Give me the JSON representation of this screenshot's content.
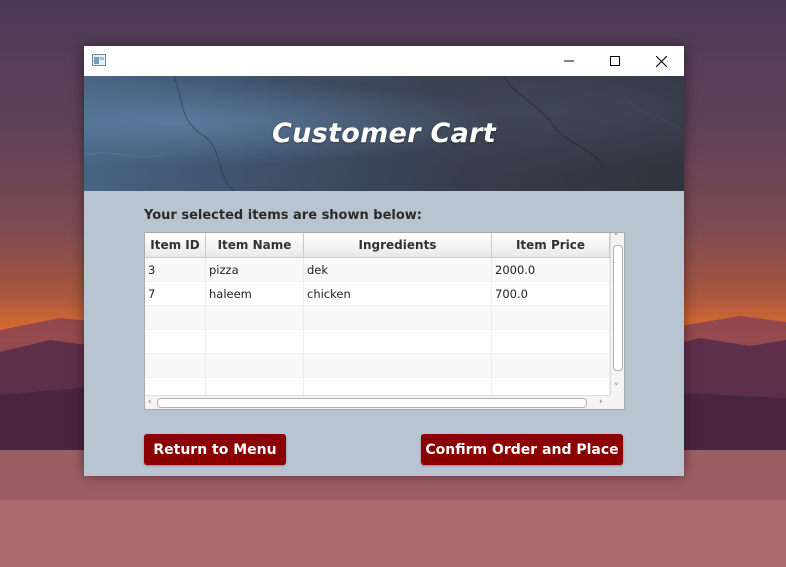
{
  "window": {
    "icon": "app-window-icon",
    "controls": {
      "minimize_icon": "minimize-icon",
      "maximize_icon": "maximize-icon",
      "close_icon": "close-icon"
    }
  },
  "banner": {
    "title": "Customer Cart"
  },
  "cart": {
    "subtitle": "Your selected items are shown below:",
    "columns": [
      "Item ID",
      "Item Name",
      "Ingredients",
      "Item Price"
    ],
    "rows": [
      [
        "3",
        "pizza",
        "dek",
        "2000.0"
      ],
      [
        "7",
        "haleem",
        "chicken",
        "700.0"
      ],
      [
        "",
        "",
        "",
        ""
      ],
      [
        "",
        "",
        "",
        ""
      ],
      [
        "",
        "",
        "",
        ""
      ],
      [
        "",
        "",
        "",
        ""
      ]
    ],
    "scroll_arrows": {
      "up": "˄",
      "down": "˅",
      "left": "‹",
      "right": "›"
    }
  },
  "actions": {
    "return_label": "Return to Menu",
    "confirm_label": "Confirm Order and Place"
  },
  "colors": {
    "button_bg": "#8b0000",
    "content_bg": "#b8c5d1"
  }
}
